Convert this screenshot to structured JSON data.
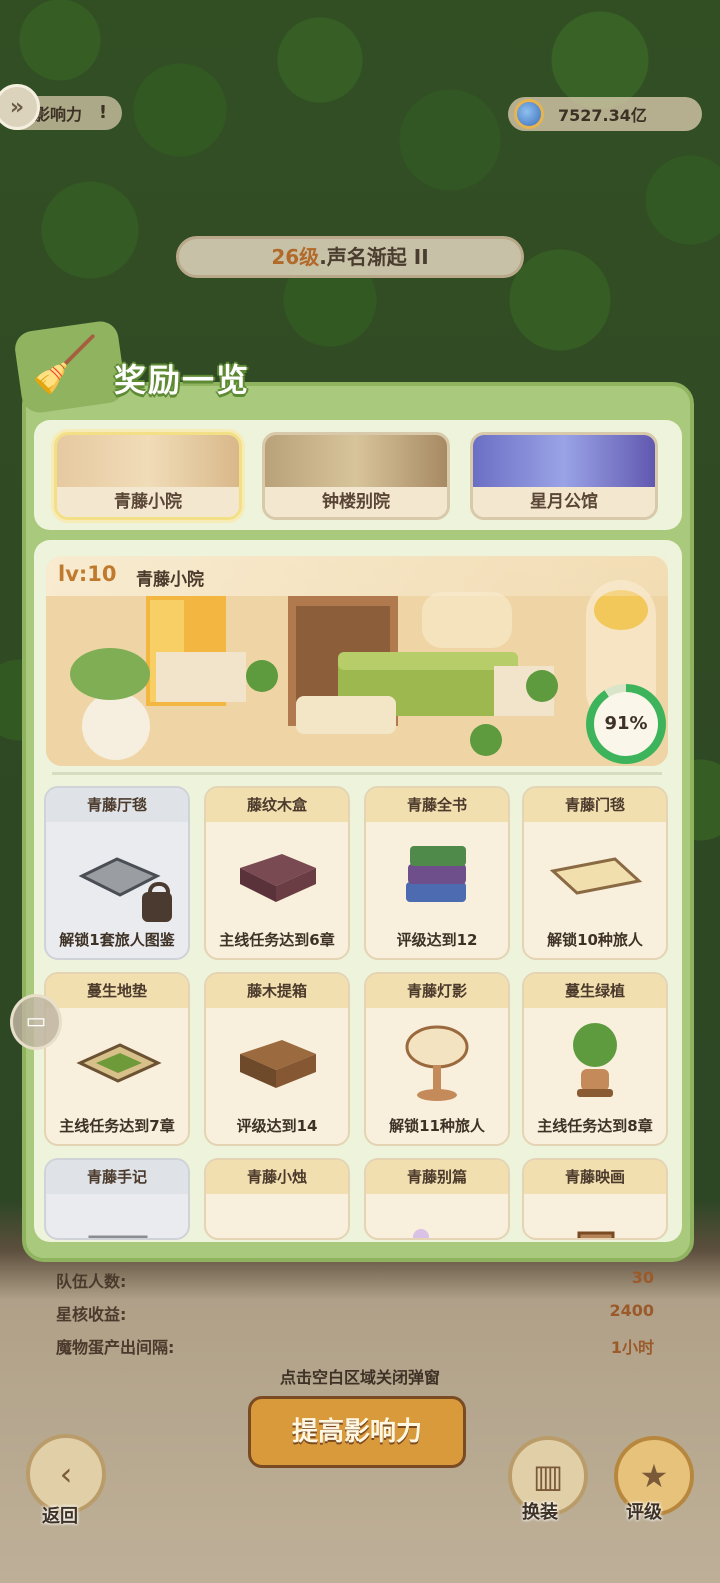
{
  "top": {
    "influence_label": "影响力",
    "info_mark": "!",
    "currency_value": "7527.34亿"
  },
  "level": {
    "level_text": "26级",
    "title_text": ".声名渐起 II"
  },
  "panel": {
    "title": "奖励一览",
    "tabs": [
      {
        "label": "青藤小院",
        "active": true
      },
      {
        "label": "钟楼别院",
        "active": false
      },
      {
        "label": "星月公馆",
        "active": false
      }
    ],
    "room": {
      "lv": "lv:10",
      "name": "青藤小院",
      "progress_text": "91%",
      "progress_value": 91
    },
    "items": [
      {
        "name": "青藤厅毯",
        "condition": "解锁1套旅人图鉴",
        "locked": true,
        "icon": "rug-icon"
      },
      {
        "name": "藤纹木盒",
        "condition": "主线任务达到6章",
        "locked": false,
        "icon": "suitcase-icon"
      },
      {
        "name": "青藤全书",
        "condition": "评级达到12",
        "locked": false,
        "icon": "books-icon"
      },
      {
        "name": "青藤门毯",
        "condition": "解锁10种旅人",
        "locked": false,
        "icon": "doormat-icon"
      },
      {
        "name": "蔓生地垫",
        "condition": "主线任务达到7章",
        "locked": false,
        "icon": "floor-mat-icon"
      },
      {
        "name": "藤木提箱",
        "condition": "评级达到14",
        "locked": false,
        "icon": "wooden-box-icon"
      },
      {
        "name": "青藤灯影",
        "condition": "解锁11种旅人",
        "locked": false,
        "icon": "lamp-icon"
      },
      {
        "name": "蔓生绿植",
        "condition": "主线任务达到8章",
        "locked": false,
        "icon": "potted-plant-icon"
      },
      {
        "name": "青藤手记",
        "condition": "",
        "locked": true,
        "icon": "notes-icon"
      },
      {
        "name": "青藤小烛",
        "condition": "",
        "locked": false,
        "icon": "candle-icon"
      },
      {
        "name": "青藤别篇",
        "condition": "",
        "locked": false,
        "icon": "mirror-icon"
      },
      {
        "name": "青藤映画",
        "condition": "",
        "locked": false,
        "icon": "frame-icon"
      }
    ]
  },
  "stats": [
    {
      "label": "队伍人数:",
      "value": "30"
    },
    {
      "label": "星核收益:",
      "value": "2400"
    },
    {
      "label": "魔物蛋产出间隔:",
      "value": "1小时"
    }
  ],
  "bottom": {
    "close_hint": "点击空白区域关闭弹窗",
    "boost_button": "提高影响力",
    "back_label": "返回",
    "dress_label": "换装",
    "rating_label": "评级"
  }
}
